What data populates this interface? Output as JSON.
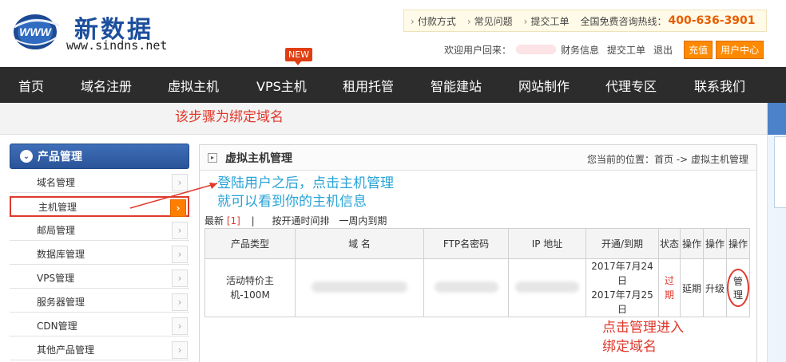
{
  "logo": {
    "name_cn": "新数据",
    "url": "www.sindns.net",
    "globe_text": "WWW"
  },
  "topbar": {
    "links": [
      "付款方式",
      "常见问题",
      "提交工单"
    ],
    "hotline_label": "全国免费咨询热线：",
    "hotline_number": "400-636-3901"
  },
  "userbar": {
    "welcome": "欢迎用户回来：",
    "links": [
      "财务信息",
      "提交工单",
      "退出"
    ],
    "recharge": "充值",
    "user_center": "用户中心"
  },
  "nav": {
    "items": [
      "首页",
      "域名注册",
      "虚拟主机",
      "VPS主机",
      "租用托管",
      "智能建站",
      "网站制作",
      "代理专区",
      "联系我们"
    ],
    "new_badge": "NEW"
  },
  "annotations": {
    "step": "该步骤为绑定域名",
    "login_line1": "登陆用户之后，点击主机管理",
    "login_line2": "就可以看到你的主机信息",
    "manage_line1": "点击管理进入",
    "manage_line2": "绑定域名"
  },
  "sidebar": {
    "header": "产品管理",
    "items": [
      "域名管理",
      "主机管理",
      "邮局管理",
      "数据库管理",
      "VPS管理",
      "服务器管理",
      "CDN管理",
      "其他产品管理"
    ]
  },
  "main": {
    "title": "虚拟主机管理",
    "breadcrumb": "您当前的位置：首页 -> 虚拟主机管理",
    "filter": {
      "latest": "最新",
      "count": "[1]",
      "sep": "|",
      "sort": "按开通时间排",
      "week": "一周内到期"
    },
    "table": {
      "headers": [
        "产品类型",
        "域 名",
        "FTP名密码",
        "IP 地址",
        "开通/到期",
        "状态",
        "操作",
        "操作",
        "操作"
      ],
      "row": {
        "product": "活动特价主机-100M",
        "open_date": "2017年7月24日",
        "expire_date": "2017年7月25日",
        "status": "过期",
        "renew": "延期",
        "upgrade": "升级",
        "manage": "管理"
      }
    }
  },
  "colors": {
    "nav_bg": "#2c2c2c",
    "accent_orange": "#ff8a00",
    "annotation_red": "#e0392d",
    "annotation_blue": "#27a3d6",
    "sidebar_blue": "#2a549a"
  }
}
